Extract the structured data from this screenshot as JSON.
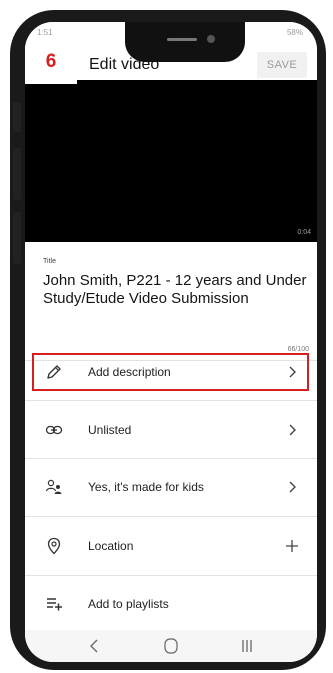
{
  "status_bar": {
    "time": "1:51",
    "right": "58%"
  },
  "step_label": "6",
  "header": {
    "title": "Edit video",
    "save_label": "SAVE"
  },
  "video": {
    "duration": "0:04"
  },
  "title_section": {
    "label": "Title",
    "value": "John Smith, P221 - 12 years and Under Study/Etude Video Submission",
    "char_count": "66/100"
  },
  "rows": [
    {
      "label": "Add description",
      "icon": "pencil-icon",
      "action": "chevron"
    },
    {
      "label": "Unlisted",
      "icon": "link-icon",
      "action": "chevron"
    },
    {
      "label": "Yes, it's made for kids",
      "icon": "audience-icon",
      "action": "chevron"
    },
    {
      "label": "Location",
      "icon": "location-pin-icon",
      "action": "plus"
    },
    {
      "label": "Add to playlists",
      "icon": "playlist-add-icon",
      "action": "none"
    }
  ],
  "highlight_color": "#d71f1f",
  "nav_icons": [
    "back-icon",
    "home-icon",
    "recents-icon"
  ]
}
